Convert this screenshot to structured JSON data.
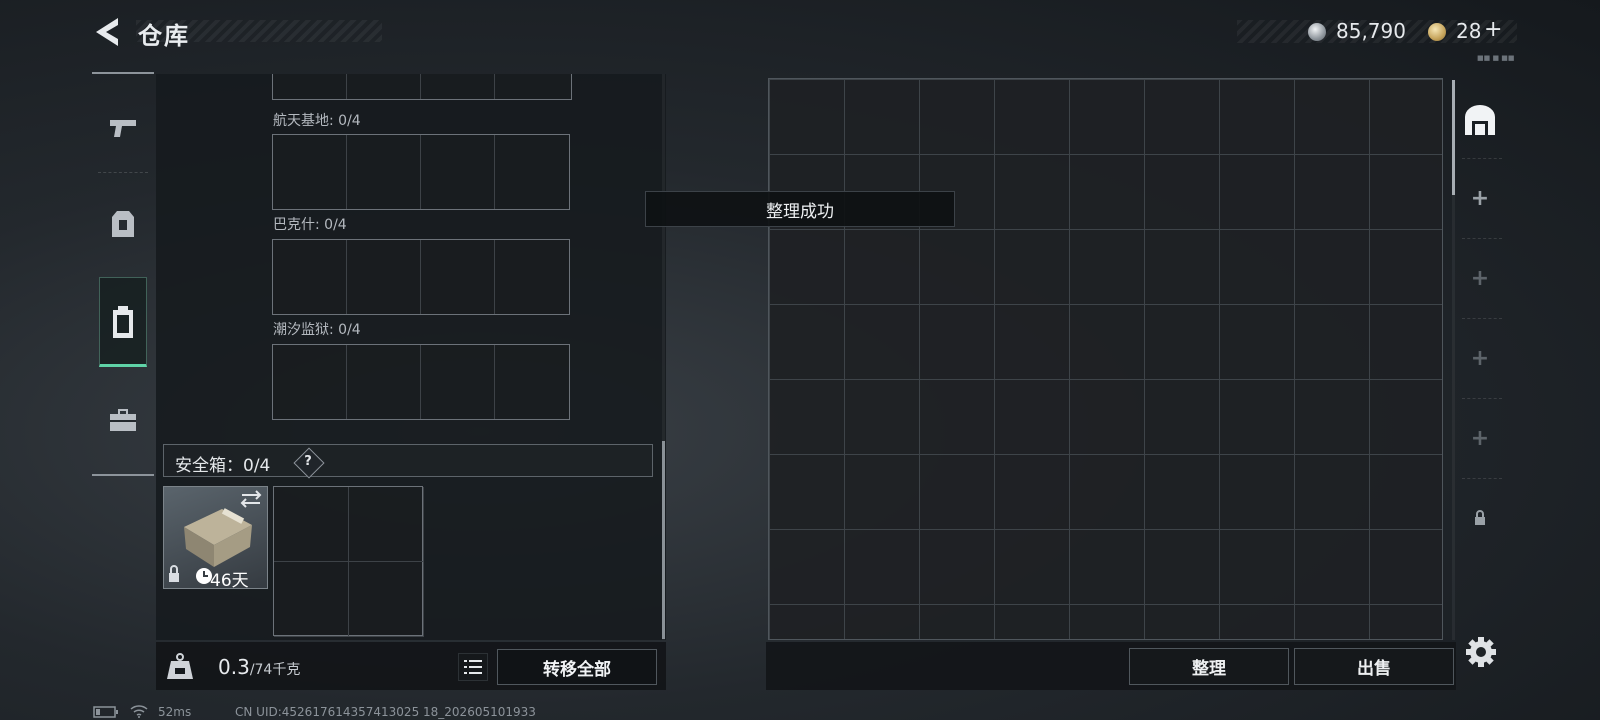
{
  "header": {
    "title": "仓库",
    "silver": "85,790",
    "gold": "28",
    "gold_plus": "+",
    "tiny": "■■ ■ ■■"
  },
  "left_nav": {
    "items": [
      "weapon-icon",
      "armor-icon",
      "backpack-icon",
      "toolbox-icon"
    ],
    "active": 2
  },
  "areas": [
    {
      "label": "航天基地: 0/4"
    },
    {
      "label": "巴克什: 0/4"
    },
    {
      "label": "潮汐监狱: 0/4"
    }
  ],
  "safe": {
    "label": "安全箱：0/4",
    "help": "?",
    "days": "46天"
  },
  "weight": {
    "value": "0.3",
    "max": "/74千克",
    "transfer_label": "转移全部"
  },
  "toast": "整理成功",
  "actions": {
    "sort_label": "整理",
    "sell_label": "出售"
  },
  "status": {
    "ping": "52ms",
    "uid": "CN UID:452617614357413025 18_202605101933"
  },
  "colors": {
    "accent": "#5fd3a7"
  }
}
